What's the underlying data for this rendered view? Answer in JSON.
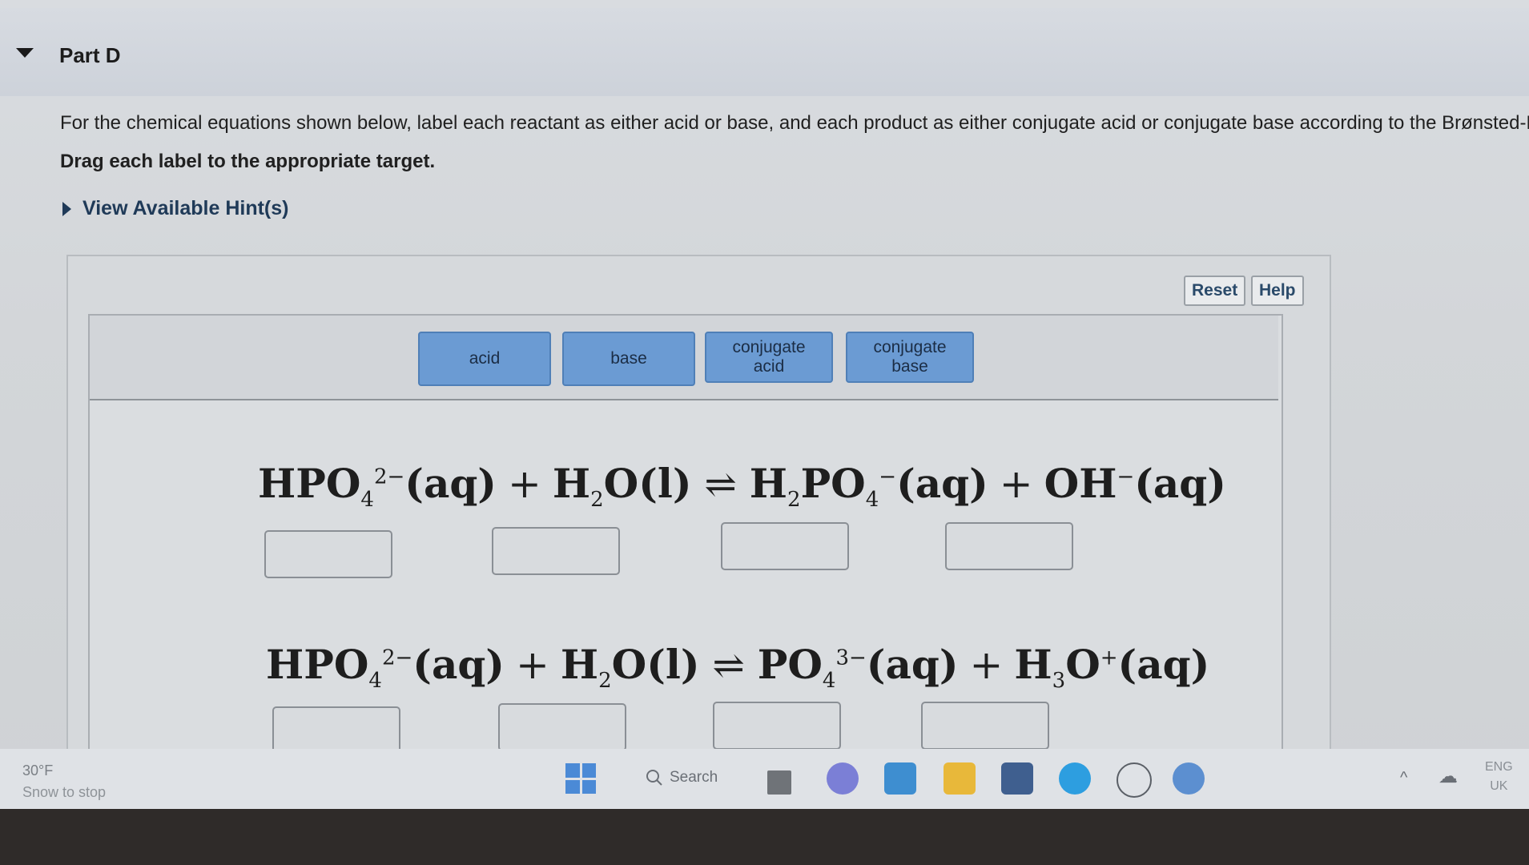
{
  "part": {
    "title": "Part D"
  },
  "instructions": {
    "line1": "For the chemical equations shown below, label each reactant as either acid or base, and each product as either conjugate acid or conjugate base according to the Brønsted-Lowry d",
    "line2": "Drag each label to the appropriate target."
  },
  "hint": {
    "label": "View Available Hint(s)"
  },
  "toolbar": {
    "reset": "Reset",
    "help": "Help"
  },
  "labels": [
    {
      "text": "acid"
    },
    {
      "text": "base"
    },
    {
      "text": "conjugate acid"
    },
    {
      "text": "conjugate base"
    }
  ],
  "equation1": {
    "r1": "HPO",
    "r1_sub": "4",
    "r1_sup": "2−",
    "r1_state": "(aq)",
    "plus1": "+",
    "r2a": "H",
    "r2_sub": "2",
    "r2b": "O",
    "r2_state": "(l)",
    "arrow": "⇌",
    "p1a": "H",
    "p1_sub1": "2",
    "p1b": "PO",
    "p1_sub2": "4",
    "p1_sup": "−",
    "p1_state": "(aq)",
    "plus2": "+",
    "p2": "OH",
    "p2_sup": "−",
    "p2_state": "(aq)"
  },
  "equation2": {
    "r1": "HPO",
    "r1_sub": "4",
    "r1_sup": "2−",
    "r1_state": "(aq)",
    "plus1": "+",
    "r2a": "H",
    "r2_sub": "2",
    "r2b": "O",
    "r2_state": "(l)",
    "arrow": "⇌",
    "p1": "PO",
    "p1_sub": "4",
    "p1_sup": "3−",
    "p1_state": "(aq)",
    "plus2": "+",
    "p2a": "H",
    "p2_sub": "3",
    "p2b": "O",
    "p2_sup": "+",
    "p2_state": "(aq)"
  },
  "taskbar": {
    "weather_temp": "30°F",
    "weather_desc": "Snow to stop",
    "search": "Search",
    "lang1": "ENG",
    "lang2": "UK"
  },
  "icons": [
    "caret-down-icon",
    "triangle-right-icon",
    "windows-start-icon",
    "search-icon",
    "file-explorer-icon",
    "chat-icon",
    "mail-icon",
    "folder-icon",
    "store-icon",
    "edge-icon",
    "dell-icon",
    "app-icon",
    "chevron-up-icon",
    "cloud-icon"
  ]
}
